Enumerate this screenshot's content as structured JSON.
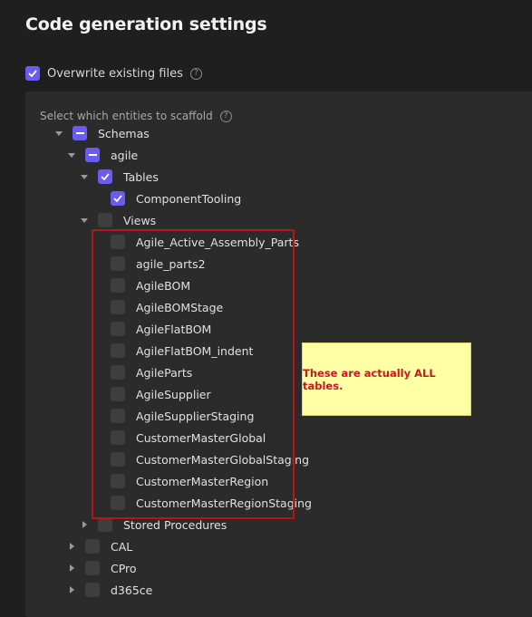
{
  "title": "Code generation settings",
  "overwrite": {
    "label": "Overwrite existing files",
    "checked": true
  },
  "scaffold_label": "Select which entities to scaffold",
  "annotation": "These are actually ALL tables.",
  "colors": {
    "accent": "#6a5cf0",
    "annotation_border": "#b8151a",
    "note_bg": "#ffffa6",
    "note_text": "#c21c1c"
  },
  "tree": [
    {
      "label": "Schemas",
      "state": "partial",
      "caret": "down",
      "level": 0
    },
    {
      "label": "agile",
      "state": "partial",
      "caret": "down",
      "level": 1
    },
    {
      "label": "Tables",
      "state": "checked",
      "caret": "down",
      "level": 2
    },
    {
      "label": "ComponentTooling",
      "state": "checked",
      "caret": "none",
      "level": 3
    },
    {
      "label": "Views",
      "state": "empty",
      "caret": "down",
      "level": 2
    },
    {
      "label": "Agile_Active_Assembly_Parts",
      "state": "empty",
      "caret": "none",
      "level": 3
    },
    {
      "label": "agile_parts2",
      "state": "empty",
      "caret": "none",
      "level": 3
    },
    {
      "label": "AgileBOM",
      "state": "empty",
      "caret": "none",
      "level": 3
    },
    {
      "label": "AgileBOMStage",
      "state": "empty",
      "caret": "none",
      "level": 3
    },
    {
      "label": "AgileFlatBOM",
      "state": "empty",
      "caret": "none",
      "level": 3
    },
    {
      "label": "AgileFlatBOM_indent",
      "state": "empty",
      "caret": "none",
      "level": 3
    },
    {
      "label": "AgileParts",
      "state": "empty",
      "caret": "none",
      "level": 3
    },
    {
      "label": "AgileSupplier",
      "state": "empty",
      "caret": "none",
      "level": 3
    },
    {
      "label": "AgileSupplierStaging",
      "state": "empty",
      "caret": "none",
      "level": 3
    },
    {
      "label": "CustomerMasterGlobal",
      "state": "empty",
      "caret": "none",
      "level": 3
    },
    {
      "label": "CustomerMasterGlobalStaging",
      "state": "empty",
      "caret": "none",
      "level": 3
    },
    {
      "label": "CustomerMasterRegion",
      "state": "empty",
      "caret": "none",
      "level": 3
    },
    {
      "label": "CustomerMasterRegionStaging",
      "state": "empty",
      "caret": "none",
      "level": 3
    },
    {
      "label": "Stored Procedures",
      "state": "empty",
      "caret": "right",
      "level": 2
    },
    {
      "label": "CAL",
      "state": "empty",
      "caret": "right",
      "level": 1
    },
    {
      "label": "CPro",
      "state": "empty",
      "caret": "right",
      "level": 1
    },
    {
      "label": "d365ce",
      "state": "empty",
      "caret": "right",
      "level": 1
    }
  ]
}
